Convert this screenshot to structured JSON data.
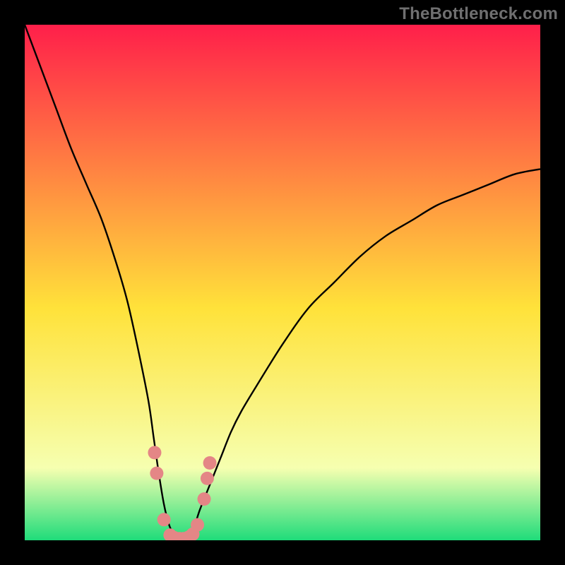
{
  "watermark": "TheBottleneck.com",
  "colors": {
    "frame": "#000000",
    "gradient_top": "#ff1f4a",
    "gradient_mid": "#ffe23a",
    "gradient_band": "#f6ffb0",
    "gradient_bottom": "#1fdc7a",
    "curve": "#000000",
    "marker": "#e48686"
  },
  "chart_data": {
    "type": "line",
    "title": "",
    "xlabel": "",
    "ylabel": "",
    "xlim": [
      0,
      100
    ],
    "ylim": [
      0,
      100
    ],
    "note": "V-shaped bottleneck curve; y reads as mismatch percentage where 0 is ideal (green band near bottom) and 100 is worst (red top). x runs over an unlabeled component scale. Values are read off the image by pixel position.",
    "series": [
      {
        "name": "bottleneck-curve",
        "x": [
          0,
          3,
          6,
          9,
          12,
          15,
          18,
          20,
          22,
          24,
          25,
          26,
          27,
          28,
          29,
          30,
          31,
          32,
          33,
          34,
          36,
          38,
          40,
          42,
          45,
          50,
          55,
          60,
          65,
          70,
          75,
          80,
          85,
          90,
          95,
          100
        ],
        "y": [
          100,
          92,
          84,
          76,
          69,
          62,
          53,
          46,
          37,
          27,
          20,
          13,
          7,
          3,
          1,
          0,
          0,
          1,
          3,
          6,
          11,
          16,
          21,
          25,
          30,
          38,
          45,
          50,
          55,
          59,
          62,
          65,
          67,
          69,
          71,
          72
        ]
      }
    ],
    "markers": {
      "name": "highlight-dots",
      "x": [
        25.2,
        25.6,
        27.0,
        28.2,
        29.0,
        30.0,
        30.8,
        31.8,
        32.6,
        33.5,
        34.8,
        35.4,
        35.9
      ],
      "y": [
        17,
        13,
        4,
        1,
        0.5,
        0.3,
        0.3,
        0.6,
        1.2,
        3,
        8,
        12,
        15
      ]
    }
  }
}
